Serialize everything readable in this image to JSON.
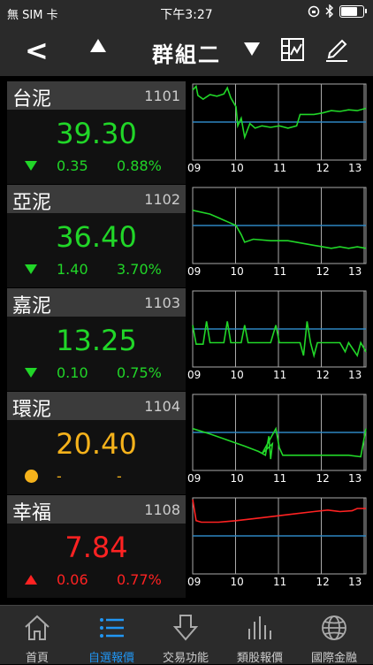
{
  "status_bar": {
    "carrier": "無 SIM 卡",
    "time": "下午3:27"
  },
  "header": {
    "title": "群組二"
  },
  "stocks": [
    {
      "name": "台泥",
      "code": "1101",
      "price": "39.30",
      "change": "0.35",
      "percent": "0.88%",
      "direction": "down",
      "color": "#21d628",
      "line_color": "#21d628",
      "series": [
        [
          0,
          0.92
        ],
        [
          0.02,
          0.97
        ],
        [
          0.03,
          0.85
        ],
        [
          0.06,
          0.8
        ],
        [
          0.1,
          0.86
        ],
        [
          0.14,
          0.84
        ],
        [
          0.18,
          0.87
        ],
        [
          0.2,
          0.95
        ],
        [
          0.22,
          0.82
        ],
        [
          0.25,
          0.7
        ],
        [
          0.26,
          0.45
        ],
        [
          0.28,
          0.55
        ],
        [
          0.3,
          0.3
        ],
        [
          0.33,
          0.48
        ],
        [
          0.36,
          0.42
        ],
        [
          0.4,
          0.45
        ],
        [
          0.45,
          0.43
        ],
        [
          0.5,
          0.45
        ],
        [
          0.55,
          0.42
        ],
        [
          0.6,
          0.45
        ],
        [
          0.62,
          0.6
        ],
        [
          0.7,
          0.6
        ],
        [
          0.75,
          0.62
        ],
        [
          0.8,
          0.65
        ],
        [
          0.85,
          0.64
        ],
        [
          0.9,
          0.66
        ],
        [
          0.95,
          0.65
        ],
        [
          1,
          0.68
        ]
      ]
    },
    {
      "name": "亞泥",
      "code": "1102",
      "price": "36.40",
      "change": "1.40",
      "percent": "3.70%",
      "direction": "down",
      "color": "#21d628",
      "line_color": "#21d628",
      "series": [
        [
          0,
          0.7
        ],
        [
          0.1,
          0.65
        ],
        [
          0.15,
          0.6
        ],
        [
          0.2,
          0.55
        ],
        [
          0.25,
          0.5
        ],
        [
          0.28,
          0.38
        ],
        [
          0.3,
          0.28
        ],
        [
          0.35,
          0.32
        ],
        [
          0.45,
          0.3
        ],
        [
          0.55,
          0.3
        ],
        [
          0.6,
          0.28
        ],
        [
          0.7,
          0.24
        ],
        [
          0.75,
          0.22
        ],
        [
          0.8,
          0.2
        ],
        [
          0.85,
          0.22
        ],
        [
          0.9,
          0.2
        ],
        [
          0.95,
          0.22
        ],
        [
          1,
          0.2
        ]
      ]
    },
    {
      "name": "嘉泥",
      "code": "1103",
      "price": "13.25",
      "change": "0.10",
      "percent": "0.75%",
      "direction": "down",
      "color": "#21d628",
      "line_color": "#21d628",
      "series": [
        [
          0,
          0.55
        ],
        [
          0.02,
          0.3
        ],
        [
          0.06,
          0.3
        ],
        [
          0.08,
          0.6
        ],
        [
          0.1,
          0.32
        ],
        [
          0.18,
          0.32
        ],
        [
          0.2,
          0.6
        ],
        [
          0.22,
          0.32
        ],
        [
          0.28,
          0.32
        ],
        [
          0.3,
          0.55
        ],
        [
          0.32,
          0.32
        ],
        [
          0.45,
          0.32
        ],
        [
          0.48,
          0.55
        ],
        [
          0.5,
          0.32
        ],
        [
          0.62,
          0.32
        ],
        [
          0.64,
          0.15
        ],
        [
          0.66,
          0.6
        ],
        [
          0.68,
          0.32
        ],
        [
          0.7,
          0.15
        ],
        [
          0.72,
          0.32
        ],
        [
          0.85,
          0.32
        ],
        [
          0.88,
          0.2
        ],
        [
          0.9,
          0.32
        ],
        [
          0.95,
          0.15
        ],
        [
          0.97,
          0.32
        ],
        [
          1,
          0.2
        ]
      ]
    },
    {
      "name": "環泥",
      "code": "1104",
      "price": "20.40",
      "change": "-",
      "percent": "-",
      "direction": "flat",
      "color": "#f5b21b",
      "line_color": "#21d628",
      "series": [
        [
          0,
          0.55
        ],
        [
          0.1,
          0.48
        ],
        [
          0.2,
          0.4
        ],
        [
          0.3,
          0.32
        ],
        [
          0.38,
          0.25
        ],
        [
          0.42,
          0.2
        ],
        [
          0.44,
          0.45
        ],
        [
          0.45,
          0.15
        ],
        [
          0.46,
          0.35
        ],
        [
          0.4,
          0.22
        ],
        [
          0.48,
          0.55
        ],
        [
          0.5,
          0.3
        ],
        [
          0.52,
          0.2
        ],
        [
          0.6,
          0.2
        ],
        [
          0.75,
          0.2
        ],
        [
          0.9,
          0.2
        ],
        [
          0.97,
          0.18
        ],
        [
          1,
          0.55
        ]
      ]
    },
    {
      "name": "幸福",
      "code": "1108",
      "price": "7.84",
      "change": "0.06",
      "percent": "0.77%",
      "direction": "up",
      "color": "#ff2222",
      "line_color": "#ff2222",
      "series": [
        [
          0,
          0.98
        ],
        [
          0.02,
          0.7
        ],
        [
          0.05,
          0.68
        ],
        [
          0.15,
          0.68
        ],
        [
          0.25,
          0.7
        ],
        [
          0.4,
          0.74
        ],
        [
          0.55,
          0.78
        ],
        [
          0.7,
          0.82
        ],
        [
          0.78,
          0.84
        ],
        [
          0.85,
          0.82
        ],
        [
          0.92,
          0.83
        ],
        [
          0.95,
          0.86
        ],
        [
          1,
          0.86
        ]
      ]
    }
  ],
  "chart_axis": {
    "ticks": [
      "09",
      "10",
      "11",
      "12",
      "13"
    ],
    "ref_color": "#2e86c1"
  },
  "tabs": [
    {
      "label": "首頁",
      "icon": "home-icon",
      "active": false
    },
    {
      "label": "自選報價",
      "icon": "watchlist-icon",
      "active": true
    },
    {
      "label": "交易功能",
      "icon": "trade-icon",
      "active": false
    },
    {
      "label": "類股報價",
      "icon": "sector-chart-icon",
      "active": false
    },
    {
      "label": "國際金融",
      "icon": "globe-icon",
      "active": false
    }
  ]
}
